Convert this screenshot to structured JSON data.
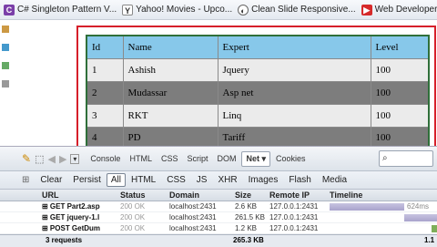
{
  "bookmarks": [
    {
      "label": "C# Singleton Pattern V...",
      "icon": "visual-studio-icon"
    },
    {
      "label": "Yahoo! Movies - Upco...",
      "icon": "yahoo-icon"
    },
    {
      "label": "Clean Slide Responsive...",
      "icon": "page-icon"
    },
    {
      "label": "Web Developer Night...",
      "icon": "youtube-icon"
    }
  ],
  "table": {
    "headers": [
      "Id",
      "Name",
      "Expert",
      "Level"
    ],
    "rows": [
      [
        "1",
        "Ashish",
        "Jquery",
        "100"
      ],
      [
        "2",
        "Mudassar",
        "Asp net",
        "100"
      ],
      [
        "3",
        "RKT",
        "Linq",
        "100"
      ],
      [
        "4",
        "PD",
        "Tariff",
        "100"
      ]
    ]
  },
  "firebug": {
    "tabs": [
      "Console",
      "HTML",
      "CSS",
      "Script",
      "DOM",
      "Net ▾",
      "Cookies"
    ],
    "active_tab": "Net ▾",
    "net_toolbar": {
      "clear": "Clear",
      "persist": "Persist",
      "filters": [
        "All",
        "HTML",
        "CSS",
        "JS",
        "XHR",
        "Images",
        "Flash",
        "Media"
      ]
    },
    "columns": [
      "URL",
      "Status",
      "Domain",
      "Size",
      "Remote IP",
      "Timeline"
    ],
    "requests": [
      {
        "url": "⊞ GET Part2.asp",
        "status": "200 OK",
        "domain": "localhost:2431",
        "size": "2.6 KB",
        "remote_ip": "127.0.0.1:2431",
        "timing_label": "624ms"
      },
      {
        "url": "⊞ GET jquery-1.l",
        "status": "200 OK",
        "domain": "localhost:2431",
        "size": "261.5 KB",
        "remote_ip": "127.0.0.1:2431",
        "timing_label": ""
      },
      {
        "url": "⊞ POST GetDum",
        "status": "200 OK",
        "domain": "localhost:2431",
        "size": "1.2 KB",
        "remote_ip": "127.0.0.1:2431",
        "timing_label": ""
      }
    ],
    "summary": {
      "count": "3 requests",
      "size": "265.3 KB",
      "time": "1.1"
    }
  },
  "colors": {
    "header_blue": "#87c8ea",
    "border_red": "#d61f2a",
    "row_dark": "#7d7d7d",
    "row_light": "#ebebeb"
  }
}
